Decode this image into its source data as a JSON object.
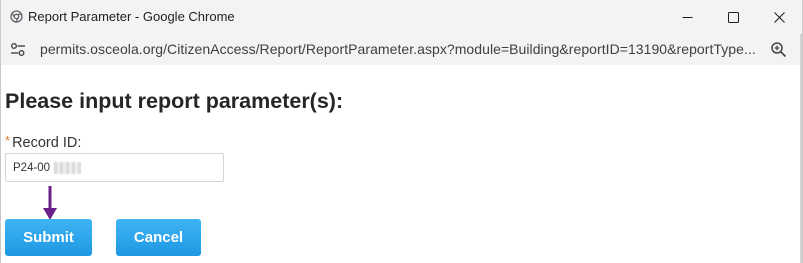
{
  "window": {
    "title": "Report Parameter - Google Chrome"
  },
  "address_bar": {
    "url": "permits.osceola.org/CitizenAccess/Report/ReportParameter.aspx?module=Building&reportID=13190&reportType..."
  },
  "icons": {
    "title": "chrome-icon",
    "minimize": "minimize-icon",
    "maximize": "maximize-icon",
    "close": "close-icon",
    "site_info": "tune-icon",
    "zoom": "zoom-icon",
    "annotation": "arrow-down-icon"
  },
  "page": {
    "heading": "Please input report parameter(s):",
    "field": {
      "required_mark": "*",
      "label": "Record ID:",
      "value": "P24-00"
    },
    "buttons": {
      "submit": "Submit",
      "cancel": "Cancel"
    }
  },
  "colors": {
    "button": "#2aa5ee",
    "required": "#e27c2c",
    "annotation_arrow": "#6a1f8a"
  }
}
